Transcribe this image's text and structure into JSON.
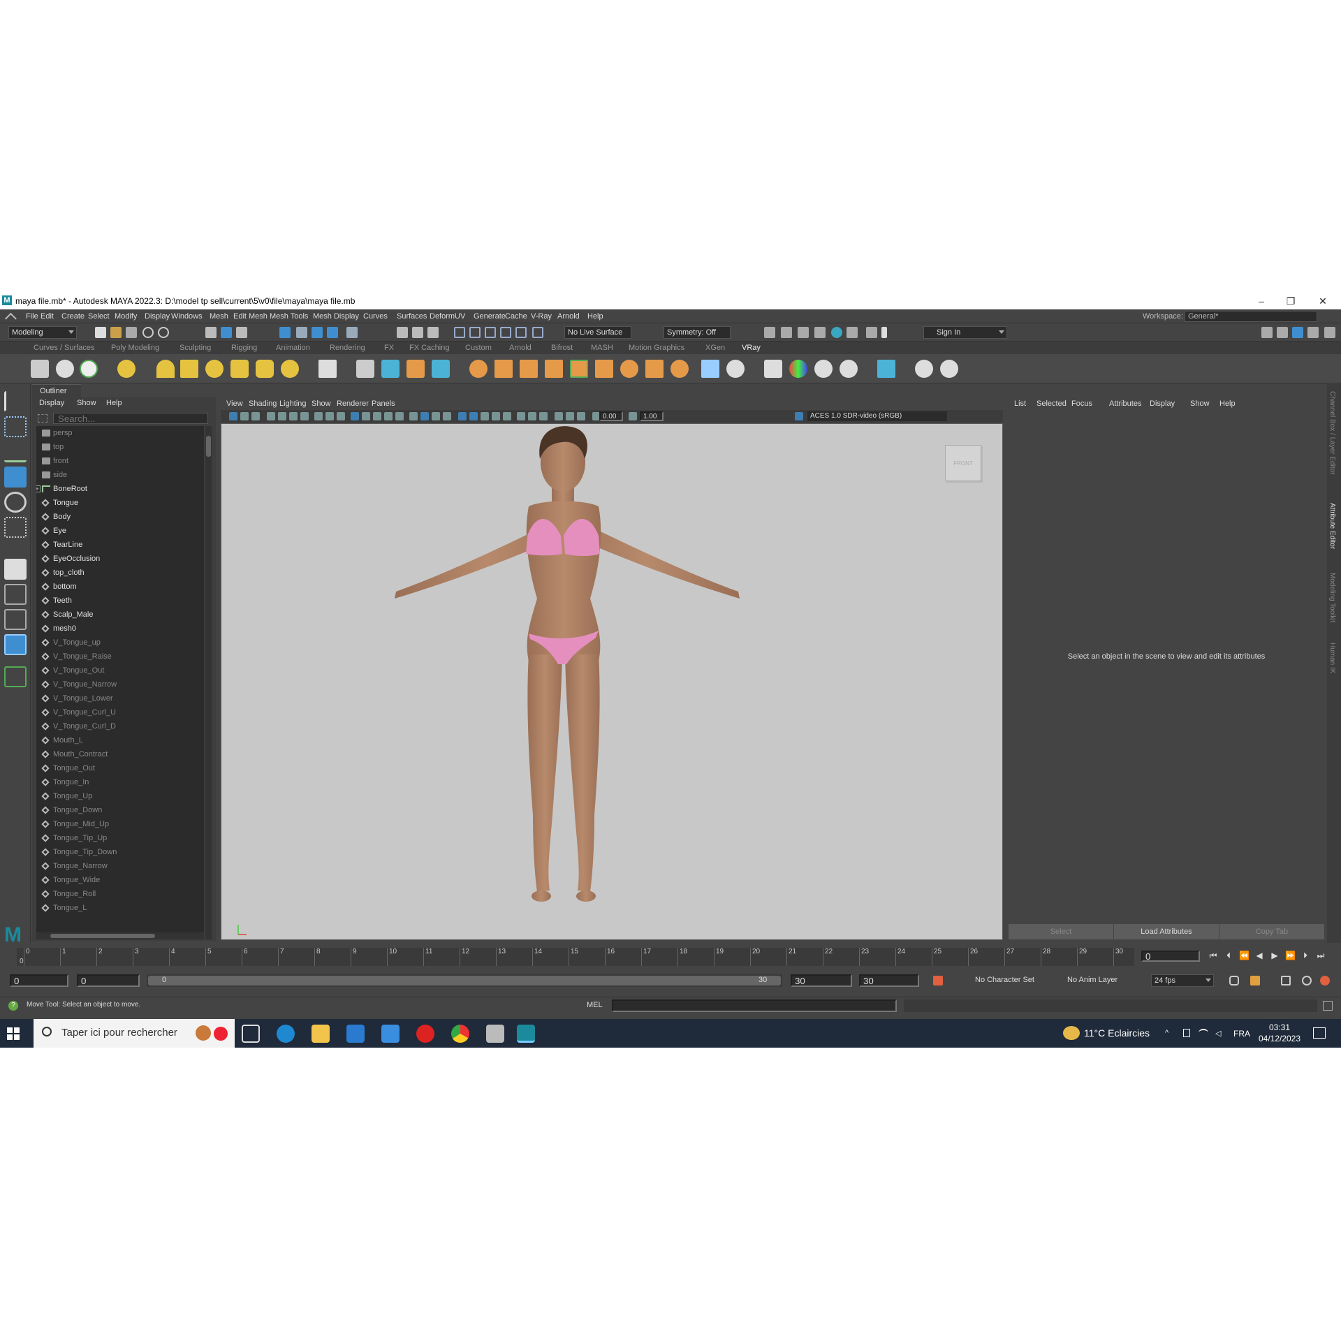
{
  "window": {
    "title": "maya file.mb* - Autodesk MAYA 2022.3: D:\\model tp sell\\current\\5\\v0\\file\\maya\\maya file.mb",
    "logo": "M",
    "minimize": "–",
    "restore": "❐",
    "close": "✕"
  },
  "menubar": {
    "items": [
      "File",
      "Edit",
      "Create",
      "Select",
      "Modify",
      "Display",
      "Windows",
      "Mesh",
      "Edit Mesh",
      "Mesh Tools",
      "Mesh Display",
      "Curves",
      "Surfaces",
      "Deform",
      "UV",
      "Generate",
      "Cache",
      "V-Ray",
      "Arnold",
      "Help"
    ],
    "workspace_label": "Workspace:",
    "workspace_value": "General*"
  },
  "statusline": {
    "mode": "Modeling",
    "live_surface": "No Live Surface",
    "symmetry": "Symmetry: Off",
    "sign_in": "Sign In"
  },
  "shelf": {
    "tabs": [
      "Curves / Surfaces",
      "Poly Modeling",
      "Sculpting",
      "Rigging",
      "Animation",
      "Rendering",
      "FX",
      "FX Caching",
      "Custom",
      "Arnold",
      "Bifrost",
      "MASH",
      "Motion Graphics",
      "XGen",
      "VRay"
    ],
    "active_tab": "VRay"
  },
  "outliner": {
    "tab": "Outliner",
    "menus": [
      "Display",
      "Show",
      "Help"
    ],
    "search_placeholder": "Search...",
    "items": [
      {
        "label": "persp",
        "type": "camera",
        "dim": true
      },
      {
        "label": "top",
        "type": "camera",
        "dim": true
      },
      {
        "label": "front",
        "type": "camera",
        "dim": true
      },
      {
        "label": "side",
        "type": "camera",
        "dim": true
      },
      {
        "label": "BoneRoot",
        "type": "joint",
        "dim": false
      },
      {
        "label": "Tongue",
        "type": "mesh",
        "dim": false
      },
      {
        "label": "Body",
        "type": "mesh",
        "dim": false
      },
      {
        "label": "Eye",
        "type": "mesh",
        "dim": false
      },
      {
        "label": "TearLine",
        "type": "mesh",
        "dim": false
      },
      {
        "label": "EyeOcclusion",
        "type": "mesh",
        "dim": false
      },
      {
        "label": "top_cloth",
        "type": "mesh",
        "dim": false
      },
      {
        "label": "bottom",
        "type": "mesh",
        "dim": false
      },
      {
        "label": "Teeth",
        "type": "mesh",
        "dim": false
      },
      {
        "label": "Scalp_Male",
        "type": "mesh",
        "dim": false
      },
      {
        "label": "mesh0",
        "type": "mesh",
        "dim": false
      },
      {
        "label": "V_Tongue_up",
        "type": "mesh",
        "dim": true
      },
      {
        "label": "V_Tongue_Raise",
        "type": "mesh",
        "dim": true
      },
      {
        "label": "V_Tongue_Out",
        "type": "mesh",
        "dim": true
      },
      {
        "label": "V_Tongue_Narrow",
        "type": "mesh",
        "dim": true
      },
      {
        "label": "V_Tongue_Lower",
        "type": "mesh",
        "dim": true
      },
      {
        "label": "V_Tongue_Curl_U",
        "type": "mesh",
        "dim": true
      },
      {
        "label": "V_Tongue_Curl_D",
        "type": "mesh",
        "dim": true
      },
      {
        "label": "Mouth_L",
        "type": "mesh",
        "dim": true
      },
      {
        "label": "Mouth_Contract",
        "type": "mesh",
        "dim": true
      },
      {
        "label": "Tongue_Out",
        "type": "mesh",
        "dim": true
      },
      {
        "label": "Tongue_In",
        "type": "mesh",
        "dim": true
      },
      {
        "label": "Tongue_Up",
        "type": "mesh",
        "dim": true
      },
      {
        "label": "Tongue_Down",
        "type": "mesh",
        "dim": true
      },
      {
        "label": "Tongue_Mid_Up",
        "type": "mesh",
        "dim": true
      },
      {
        "label": "Tongue_Tip_Up",
        "type": "mesh",
        "dim": true
      },
      {
        "label": "Tongue_Tip_Down",
        "type": "mesh",
        "dim": true
      },
      {
        "label": "Tongue_Narrow",
        "type": "mesh",
        "dim": true
      },
      {
        "label": "Tongue_Wide",
        "type": "mesh",
        "dim": true
      },
      {
        "label": "Tongue_Roll",
        "type": "mesh",
        "dim": true
      },
      {
        "label": "Tongue_L",
        "type": "mesh",
        "dim": true
      }
    ]
  },
  "viewport": {
    "menus": [
      "View",
      "Shading",
      "Lighting",
      "Show",
      "Renderer",
      "Panels"
    ],
    "exposure": "0.00",
    "gamma": "1.00",
    "color_management": "ACES 1.0 SDR-video (sRGB)",
    "viewcube_label": "FRONT"
  },
  "attribute_editor": {
    "menus": [
      "List",
      "Selected",
      "Focus",
      "Attributes",
      "Display",
      "Show",
      "Help"
    ],
    "message": "Select an object in the scene to view and edit its attributes",
    "buttons": {
      "select": "Select",
      "load": "Load Attributes",
      "copy": "Copy Tab"
    },
    "side_tabs": [
      "Channel Box / Layer Editor",
      "Attribute Editor",
      "Modeling Toolkit",
      "Human IK"
    ]
  },
  "timeline": {
    "ticks": [
      "0",
      "1",
      "2",
      "3",
      "4",
      "5",
      "6",
      "7",
      "8",
      "9",
      "10",
      "11",
      "12",
      "13",
      "14",
      "15",
      "16",
      "17",
      "18",
      "19",
      "20",
      "21",
      "22",
      "23",
      "24",
      "25",
      "26",
      "27",
      "28",
      "29",
      "30"
    ],
    "current_frame": "0",
    "current_marker": "0"
  },
  "range": {
    "start": "0",
    "anim_start": "0",
    "slider_start": "0",
    "slider_end": "30",
    "end": "30",
    "anim_end": "30",
    "character_set": "No Character Set",
    "anim_layer": "No Anim Layer",
    "fps": "24 fps"
  },
  "commandline": {
    "help": "Move Tool: Select an object to move.",
    "mel": "MEL"
  },
  "taskbar": {
    "search": "Taper ici pour rechercher",
    "weather": "11°C  Eclaircies",
    "lang": "FRA",
    "time": "03:31",
    "date": "04/12/2023"
  },
  "colors": {
    "accent": "#1b8a9c",
    "bg": "#444444",
    "viewport": "#c8c8c8",
    "skin": "#b08468",
    "bikini": "#e58fbf"
  }
}
